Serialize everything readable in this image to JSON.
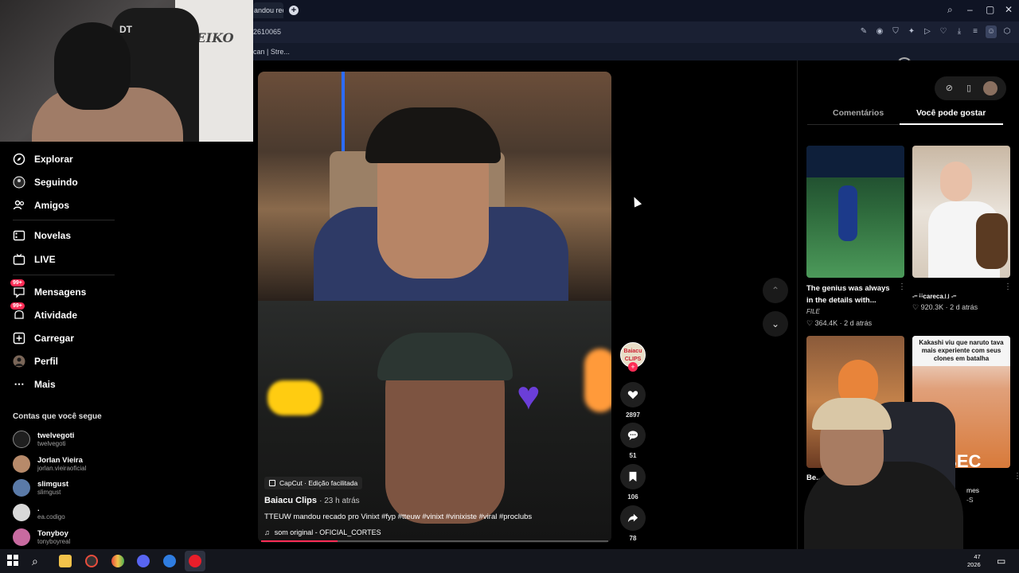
{
  "browser": {
    "tab_title": "andou reca",
    "url": "2610065",
    "bookmark": "can | Stre...",
    "toolbar_icons": [
      "pencil-icon",
      "camera-icon",
      "shield-icon",
      "extension-icon",
      "play-icon",
      "heart-icon",
      "download-icon",
      "menu-icon",
      "profile-icon",
      "box-icon"
    ]
  },
  "webcam": {
    "logo": "DT",
    "wall_text": "YEIKO"
  },
  "sidebar": {
    "items": [
      {
        "label": "Explorar",
        "icon": "compass-icon"
      },
      {
        "label": "Seguindo",
        "icon": "following-icon"
      },
      {
        "label": "Amigos",
        "icon": "friends-icon"
      },
      {
        "label": "Novelas",
        "icon": "novelas-icon"
      },
      {
        "label": "LIVE",
        "icon": "live-icon"
      },
      {
        "label": "Mensagens",
        "icon": "messages-icon",
        "badge": "99+"
      },
      {
        "label": "Atividade",
        "icon": "activity-icon",
        "badge": "99+"
      },
      {
        "label": "Carregar",
        "icon": "upload-icon"
      },
      {
        "label": "Perfil",
        "icon": "profile-icon"
      },
      {
        "label": "Mais",
        "icon": "more-icon"
      }
    ],
    "following_title": "Contas que você segue",
    "accounts": [
      {
        "name": "twelvegoti",
        "user": "twelvegoti"
      },
      {
        "name": "Jorlan Vieira",
        "user": "jorlan.vieiraoficial"
      },
      {
        "name": "slimgust",
        "user": "slimgust"
      },
      {
        "name": ".",
        "user": "ea.codigo"
      },
      {
        "name": "Tonyboy",
        "user": "tonyboyreal"
      }
    ]
  },
  "video": {
    "capcut": "CapCut · Edição facilitada",
    "author": "Baiacu Clips",
    "time": "· 23 h atrás",
    "description": "TTEUW mandou recado pro Vinixt #fyp #tteuw #vinixt #vinixiste #viral #proclubs",
    "sound": "som original - OFICIAL_CORTES",
    "progress": 0.22,
    "creator_avatar_text": "Baiacu CLIPS"
  },
  "actions": {
    "likes": "2897",
    "comments": "51",
    "saves": "106",
    "shares": "78"
  },
  "right_panel": {
    "tabs": [
      "Comentários",
      "Você pode gostar"
    ],
    "active_tab": "Você pode gostar",
    "cards": [
      {
        "caption": "The genius was always in the details with...",
        "tag": "FILE",
        "likes": "364.4K",
        "age": "2 d atrás"
      },
      {
        "caption": "-᠆ ꜟꜟcareca꜌꜌ -᠆",
        "likes": "920.3K",
        "age": "2 d atrás"
      },
      {
        "caption": "Be... es... n...",
        "likes": "",
        "age": ""
      },
      {
        "caption": "Kakashi viu que naruto tava mais experiente com seus clones em batalha",
        "overlay": "BEC",
        "extra": "mes",
        "extra2": "-S"
      }
    ]
  },
  "taskbar": {
    "time": "47",
    "date": "2026"
  }
}
